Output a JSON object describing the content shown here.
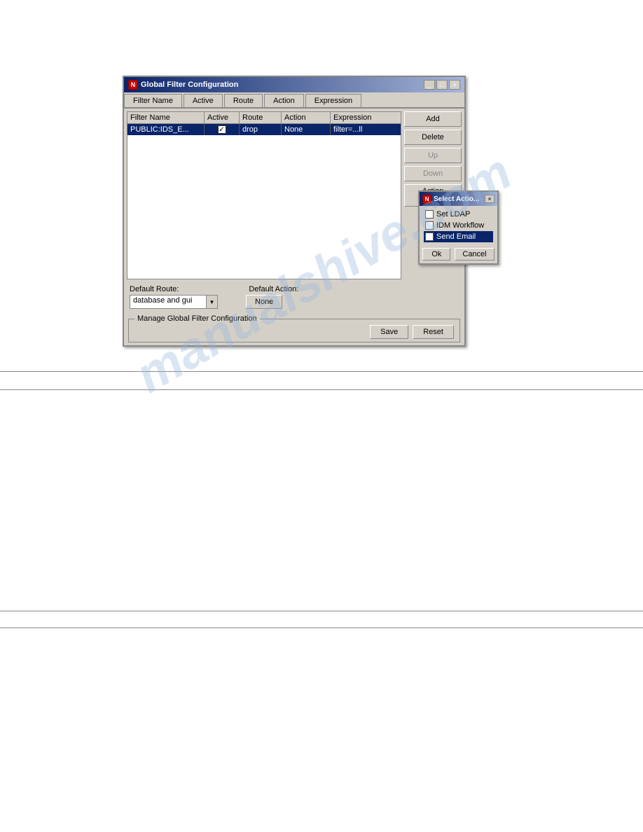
{
  "watermark": "manualshive.com",
  "dialog": {
    "title": "Global Filter Configuration",
    "tabs": [
      {
        "label": "Filter Name"
      },
      {
        "label": "Active"
      },
      {
        "label": "Route"
      },
      {
        "label": "Action"
      },
      {
        "label": "Expression"
      }
    ],
    "table": {
      "headers": [
        "Filter Name",
        "Active",
        "Route",
        "Action",
        "Expression"
      ],
      "rows": [
        {
          "name": "PUBLIC:IDS_E...",
          "active": true,
          "route": "drop",
          "action": "None",
          "expression": "filter=...ll"
        }
      ]
    },
    "buttons": {
      "add": "Add",
      "delete": "Delete",
      "up": "Up",
      "down": "Down",
      "action_manager": "Action Manager"
    },
    "default_route_label": "Default Route:",
    "default_route_value": "database and gui",
    "default_action_label": "Default Action:",
    "default_action_value": "None",
    "manage_section": {
      "legend": "Manage Global Filter Configuration",
      "save": "Save",
      "reset": "Reset"
    }
  },
  "popup": {
    "title": "Select Actio...",
    "items": [
      {
        "label": "Set LDAP",
        "checked": false,
        "selected": false
      },
      {
        "label": "IDM Workflow",
        "checked": false,
        "selected": false
      },
      {
        "label": "Send Email",
        "checked": true,
        "selected": true
      }
    ],
    "ok_label": "Ok",
    "cancel_label": "Cancel"
  }
}
